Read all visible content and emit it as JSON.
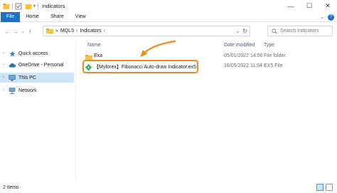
{
  "window": {
    "title": "Indicators",
    "controls": {
      "minimize": "—",
      "maximize": "☐",
      "close": "✕"
    }
  },
  "ribbon": {
    "tabs": [
      "File",
      "Home",
      "Share",
      "View"
    ],
    "collapse_glyph": "⌄",
    "help_glyph": "?"
  },
  "nav": {
    "back": "←",
    "forward": "→",
    "recent": "⌄",
    "up": "↑"
  },
  "address": {
    "overflow": "«",
    "crumbs": [
      "MQL5",
      "Indicators"
    ],
    "separator": "›",
    "dropdown": "⌄",
    "refresh": "↻"
  },
  "search": {
    "placeholder": "Search Indicators"
  },
  "sidebar": {
    "items": [
      {
        "label": "Quick access",
        "icon": "star-icon"
      },
      {
        "label": "OneDrive - Personal",
        "icon": "cloud-icon"
      },
      {
        "label": "This PC",
        "icon": "computer-icon"
      },
      {
        "label": "Network",
        "icon": "network-icon"
      }
    ]
  },
  "columns": {
    "name": "Name",
    "date": "Date modified",
    "type": "Type"
  },
  "files": [
    {
      "name": "Exa",
      "date": "05/01/2022 14:56",
      "type": "File folder",
      "icon": "folder-icon"
    },
    {
      "name": "【Myforex】Fibonacci Auto-draw Indicator.ex5",
      "date": "16/05/2022 11:04",
      "type": "EX5 File",
      "icon": "gear-icon"
    }
  ],
  "status": {
    "items": "2 items"
  },
  "colors": {
    "accent": "#1a73c9",
    "highlight": "#f08c1e",
    "selected": "#cce4f7",
    "folder": "#f5c542",
    "gear": "#2e9e4a"
  }
}
